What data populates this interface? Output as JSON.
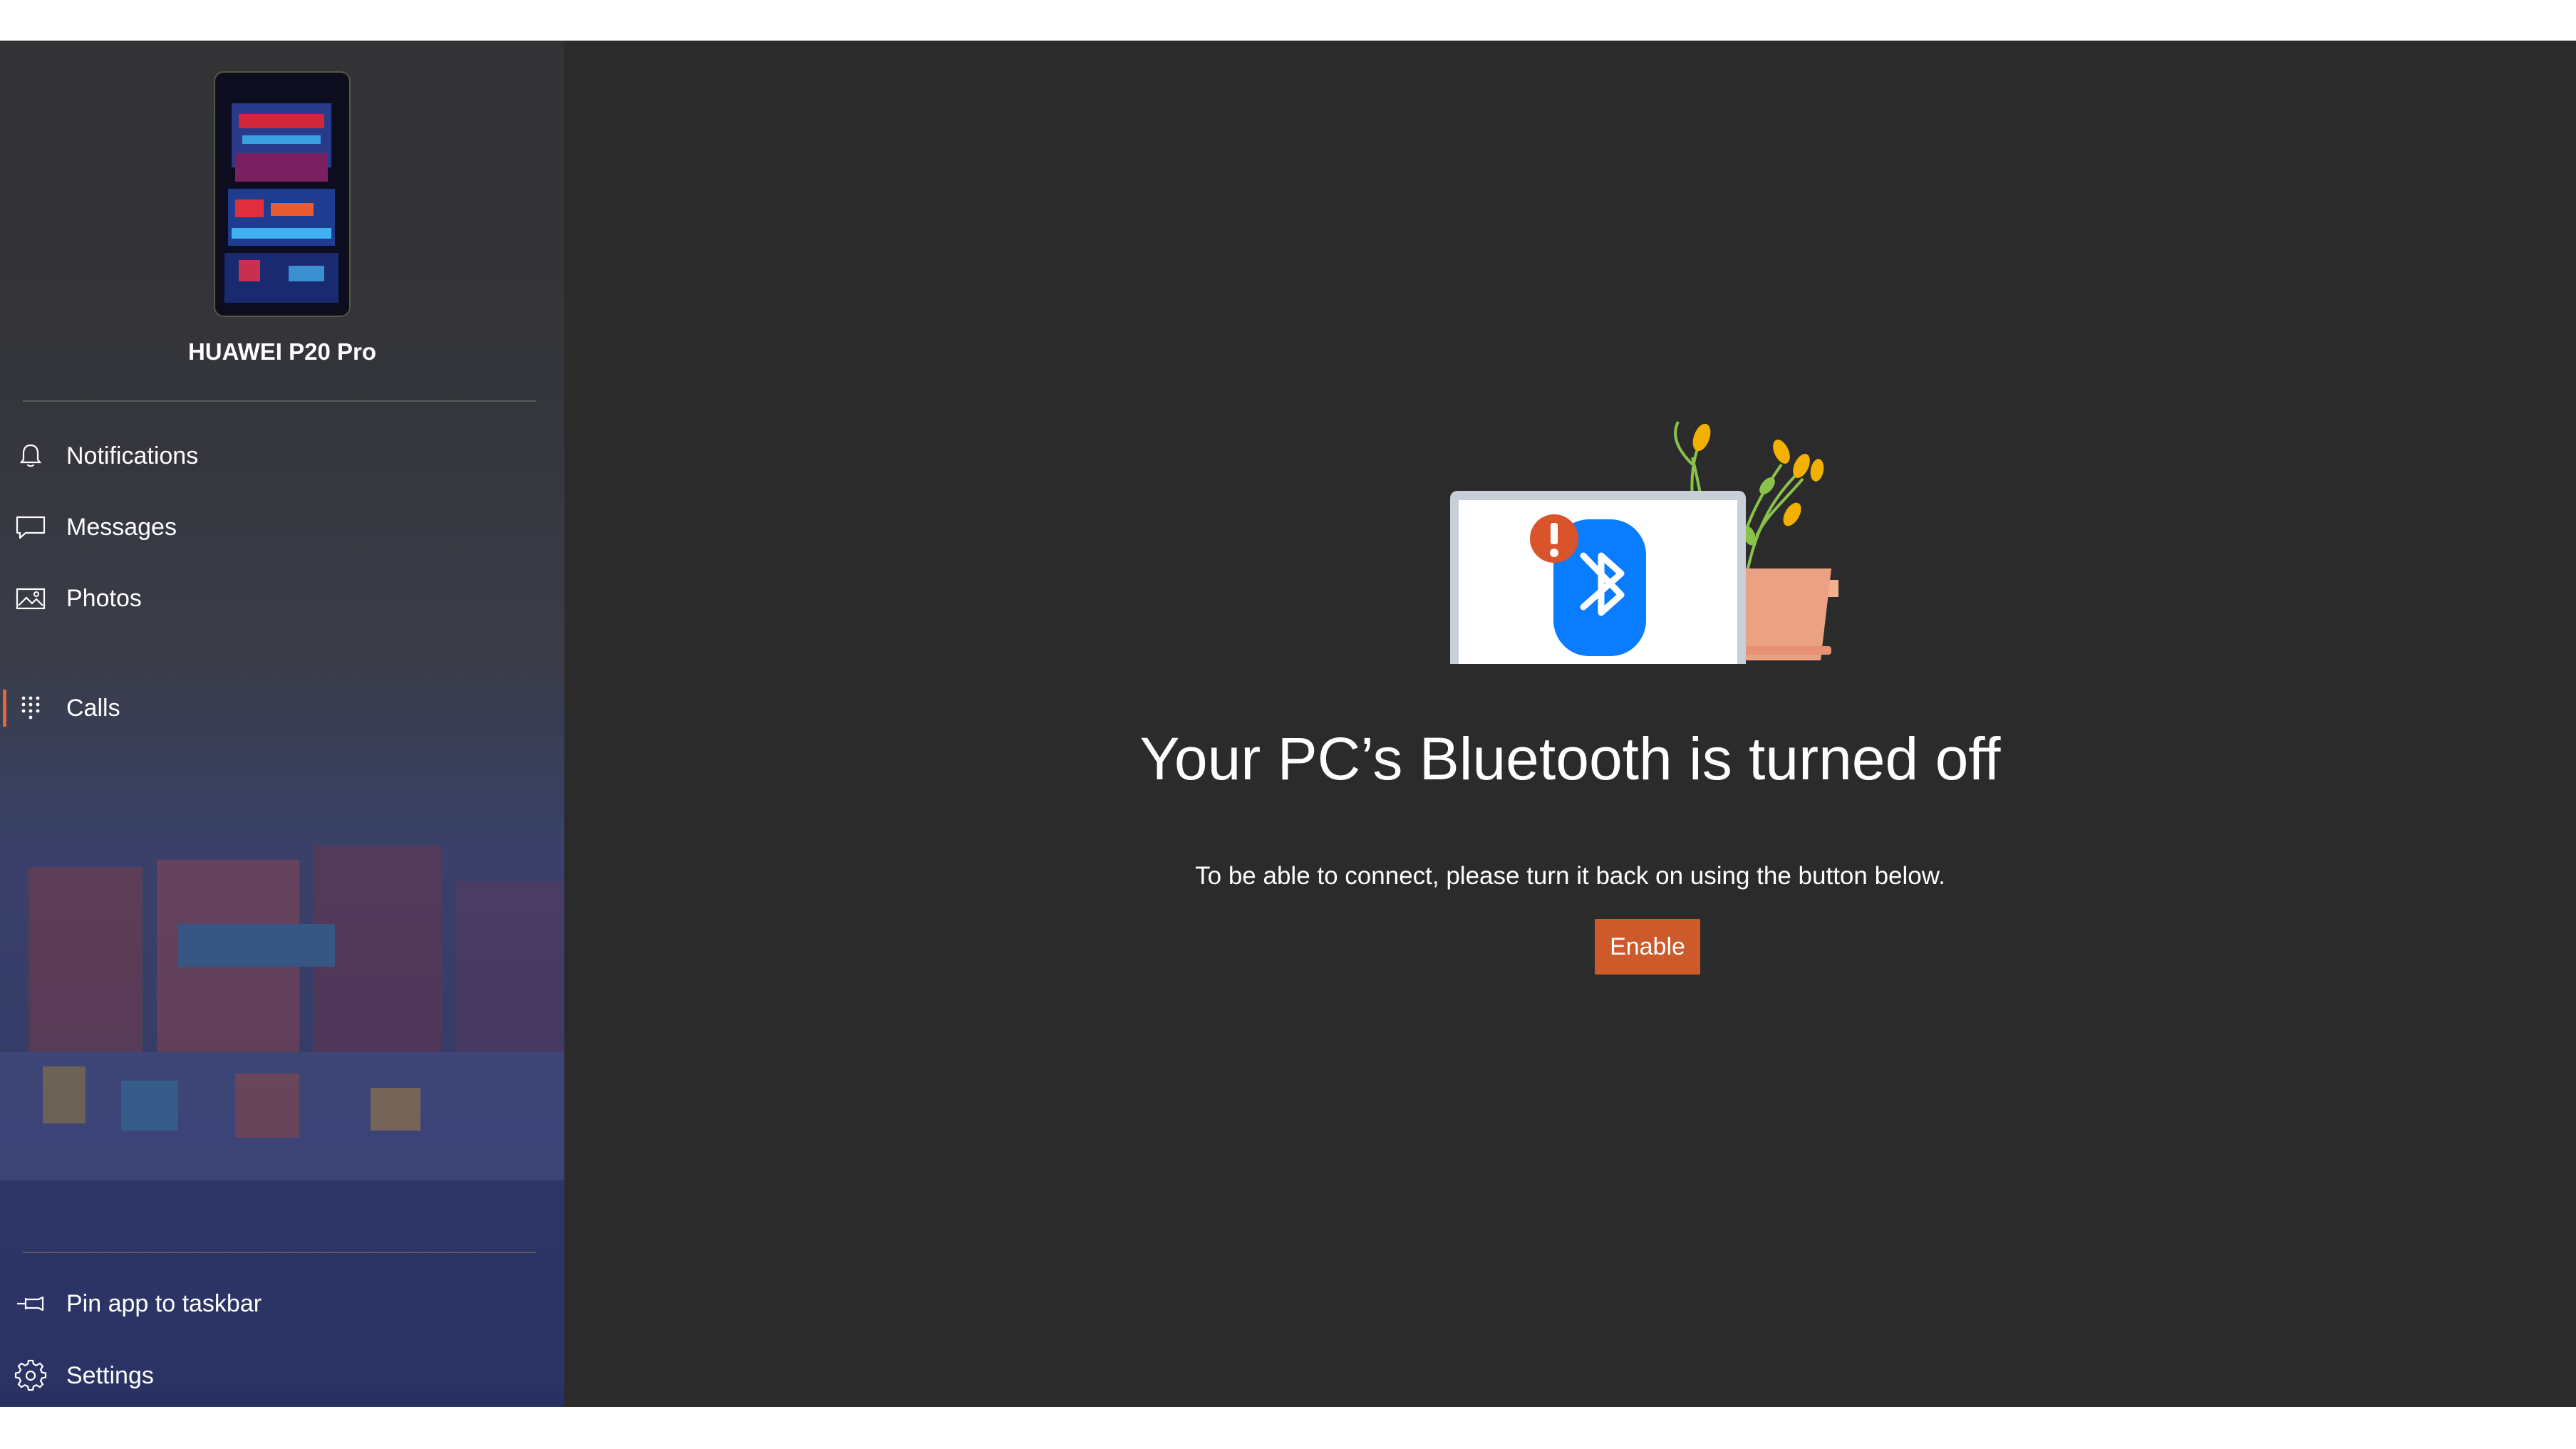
{
  "device": {
    "name": "HUAWEI P20 Pro"
  },
  "sidebar": {
    "items": [
      {
        "label": "Notifications",
        "icon": "bell-icon"
      },
      {
        "label": "Messages",
        "icon": "message-icon"
      },
      {
        "label": "Photos",
        "icon": "photo-icon"
      },
      {
        "label": "Calls",
        "icon": "dialpad-icon",
        "selected": true
      }
    ],
    "footer_items": [
      {
        "label": "Pin app to taskbar",
        "icon": "pin-icon"
      },
      {
        "label": "Settings",
        "icon": "gear-icon"
      }
    ]
  },
  "main": {
    "title": "Your PC’s Bluetooth is turned off",
    "subtitle": "To be able to connect, please turn it back on using the button below.",
    "enable_label": "Enable"
  },
  "colors": {
    "accent": "#cd5a2a",
    "bluetooth": "#0a7cff",
    "alert": "#d9532b",
    "background": "#2b2b2b"
  }
}
